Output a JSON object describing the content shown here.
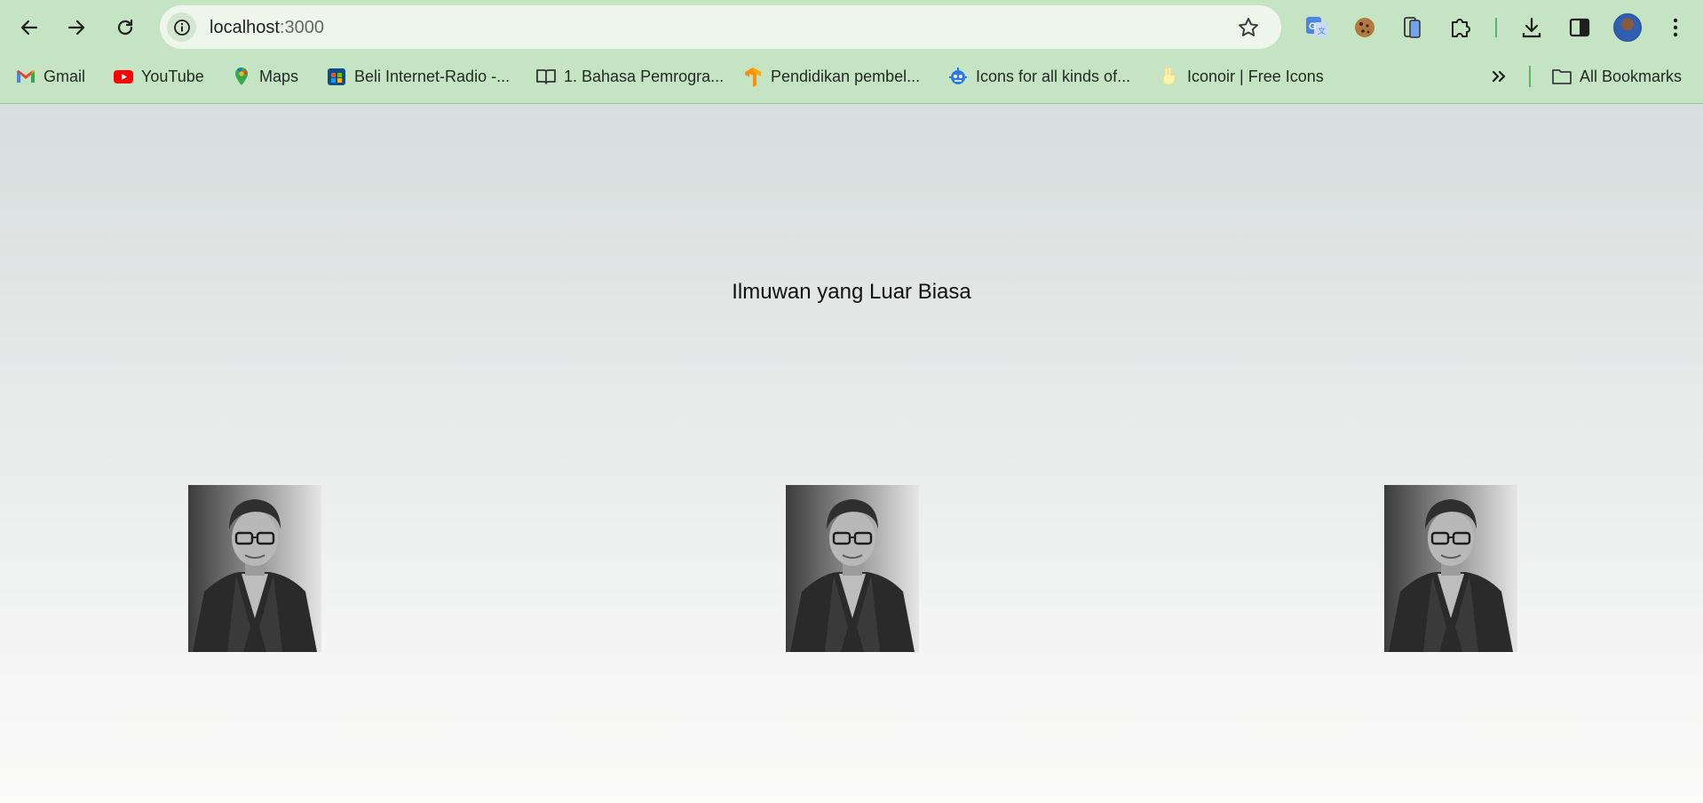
{
  "browser": {
    "url_host": "localhost",
    "url_port": ":3000",
    "bookmarks": [
      {
        "label": "Gmail",
        "icon": "gmail-icon"
      },
      {
        "label": "YouTube",
        "icon": "youtube-icon"
      },
      {
        "label": "Maps",
        "icon": "maps-icon"
      },
      {
        "label": "Beli Internet-Radio -...",
        "icon": "store-icon"
      },
      {
        "label": "1. Bahasa Pemrogra...",
        "icon": "book-icon"
      },
      {
        "label": "Pendidikan pembel...",
        "icon": "tensorflow-icon"
      },
      {
        "label": "Icons for all kinds of...",
        "icon": "robot-icon"
      },
      {
        "label": "Iconoir | Free Icons",
        "icon": "peace-hand-icon"
      }
    ],
    "all_bookmarks_label": "All Bookmarks",
    "colors": {
      "chrome": "#c5e4c3",
      "omnibox": "#eef6ec",
      "accent": "#5fb36a"
    }
  },
  "page": {
    "heading": "Ilmuwan yang Luar Biasa",
    "images": [
      {
        "alt": "portrait-photo"
      },
      {
        "alt": "portrait-photo"
      },
      {
        "alt": "portrait-photo"
      }
    ]
  }
}
